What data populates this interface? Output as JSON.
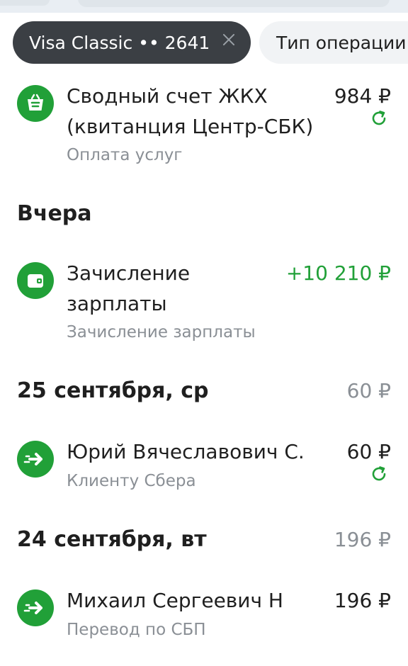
{
  "filters": {
    "card_chip": "Visa Classic •• 2641",
    "type_chip": "Тип операции"
  },
  "operations": {
    "housing": {
      "title_line1": "Сводный счет ЖКХ",
      "title_line2": "(квитанция Центр-СБК)",
      "category": "Оплата услуг",
      "amount": "984 ₽",
      "icon": "shopping-basket-icon"
    },
    "salary": {
      "title_line1": "Зачисление",
      "title_line2": "зарплаты",
      "category": "Зачисление зарплаты",
      "amount": "+10 210 ₽",
      "icon": "wallet-icon"
    },
    "transfer_yuri": {
      "title": "Юрий Вячеславович С.",
      "category": "Клиенту Сбера",
      "amount": "60 ₽",
      "icon": "transfer-arrow-icon"
    },
    "transfer_mikhail": {
      "title": "Михаил Сергеевич Н",
      "category": "Перевод по СБП",
      "amount": "196 ₽",
      "icon": "transfer-arrow-icon"
    }
  },
  "sections": {
    "yesterday": {
      "label": "Вчера"
    },
    "sep25": {
      "label": "25 сентября, ср",
      "total": "60 ₽"
    },
    "sep24": {
      "label": "24 сентября, вт",
      "total": "196 ₽"
    }
  },
  "colors": {
    "accent_green": "#21a038",
    "chip_dark": "#3b3f44",
    "secondary_text": "#8a8f95"
  }
}
